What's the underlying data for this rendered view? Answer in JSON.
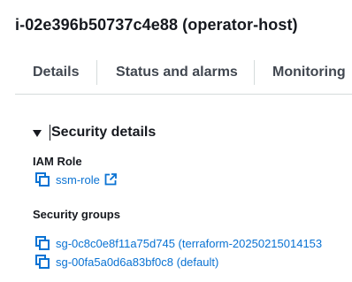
{
  "header": {
    "title": "i-02e396b50737c4e88 (operator-host)"
  },
  "tabs": [
    {
      "label": "Details"
    },
    {
      "label": "Status and alarms"
    },
    {
      "label": "Monitoring"
    }
  ],
  "security": {
    "section_title": "Security details",
    "expanded": true,
    "iam_role_label": "IAM Role",
    "iam_role_value": "ssm-role",
    "security_groups_label": "Security groups",
    "security_groups": [
      {
        "value": "sg-0c8c0e8f11a75d745 (terraform-20250215014153"
      },
      {
        "value": "sg-00fa5a0d6a83bf0c8 (default)"
      }
    ]
  },
  "colors": {
    "link": "#0972d3",
    "text": "#16191f",
    "tab_text": "#414750",
    "divider": "#d5dbdb"
  },
  "icons": {
    "copy": "copy-icon",
    "external": "external-link-icon",
    "caret": "caret-down-icon"
  }
}
